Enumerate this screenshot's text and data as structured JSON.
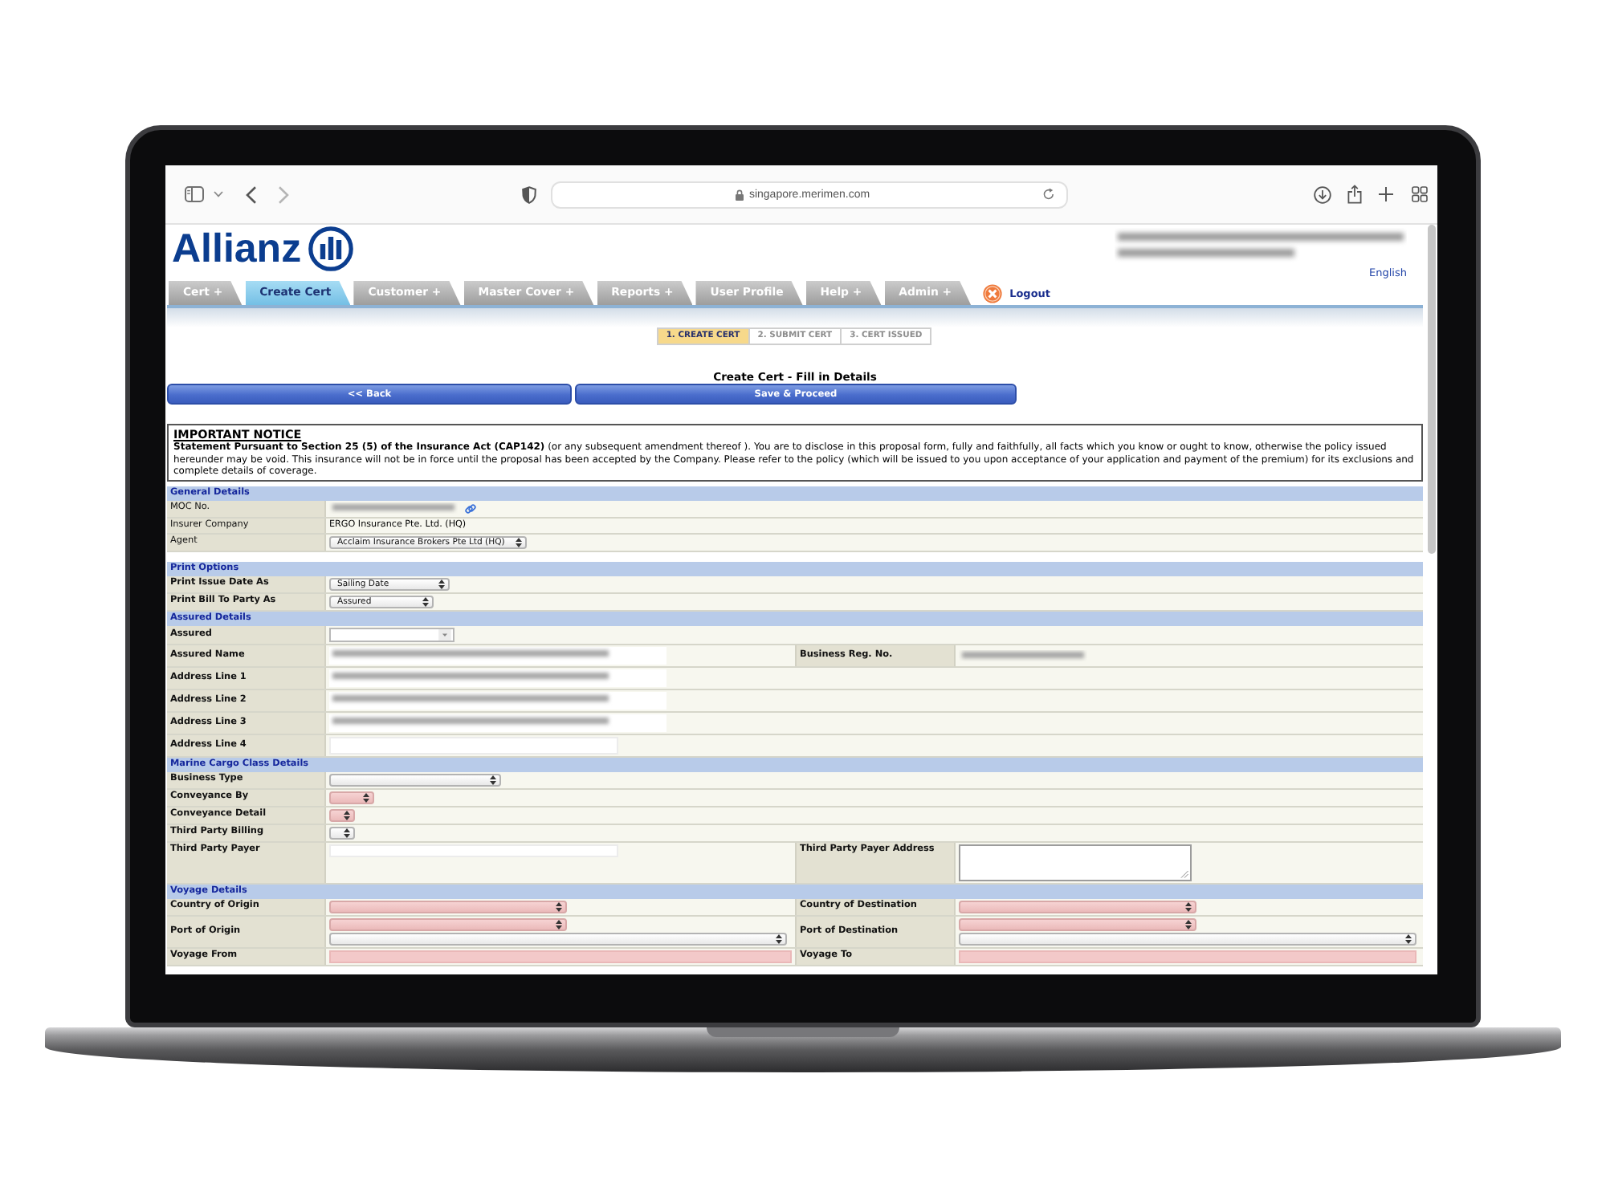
{
  "browser": {
    "url": "singapore.merimen.com"
  },
  "header": {
    "logo": "Allianz",
    "user_info_blurred": true,
    "language": "English"
  },
  "tabs": [
    {
      "label": "Cert +",
      "selected": false
    },
    {
      "label": "Create Cert",
      "selected": true
    },
    {
      "label": "Customer +",
      "selected": false
    },
    {
      "label": "Master Cover +",
      "selected": false
    },
    {
      "label": "Reports +",
      "selected": false
    },
    {
      "label": "User Profile",
      "selected": false
    },
    {
      "label": "Help +",
      "selected": false
    },
    {
      "label": "Admin +",
      "selected": false
    }
  ],
  "logout": "Logout",
  "steps": [
    {
      "label": "1. CREATE CERT",
      "selected": true
    },
    {
      "label": "2. SUBMIT CERT",
      "selected": false
    },
    {
      "label": "3. CERT ISSUED",
      "selected": false
    }
  ],
  "title": "Create Cert - Fill in Details",
  "buttons": [
    "<< Back",
    "Save & Proceed"
  ],
  "notice": {
    "heading": "IMPORTANT NOTICE",
    "text": "**Statement Pursuant to Section 25 (5) of the Insurance Act (CAP142)** (or any subsequent amendment thereof ). You are to disclose in this proposal form, fully and faithfully, all facts which you know or ought to know, otherwise the policy issued hereunder may be void. This insurance will not be in force until the proposal has been accepted by the Company. Please refer to the policy (which will be issued to you upon acceptance of your application and payment of the premium) for its exclusions and complete details of coverage."
  },
  "sections": [
    {
      "title": "General Details",
      "bold_labels": false,
      "rows": [
        {
          "label": "MOC No.",
          "fields": [
            {
              "kind": "blurred",
              "linked": true
            }
          ]
        },
        {
          "label": "Insurer Company",
          "fields": [
            {
              "kind": "text",
              "value": "ERGO Insurance Pte. Ltd. (HQ)"
            }
          ]
        },
        {
          "label": "Agent",
          "fields": [
            {
              "kind": "select",
              "value": "Acclaim Insurance Brokers Pte Ltd (HQ)",
              "required": false
            }
          ]
        }
      ]
    },
    {
      "title": "Print Options",
      "bold_labels": true,
      "rows": [
        {
          "label": "Print Issue Date As",
          "fields": [
            {
              "kind": "select",
              "value": "Sailing Date",
              "required": false
            }
          ]
        },
        {
          "label": "Print Bill To Party As",
          "fields": [
            {
              "kind": "select",
              "value": "Assured",
              "required": false
            }
          ]
        }
      ]
    },
    {
      "title": "Assured Details",
      "bold_labels": true,
      "rows": [
        {
          "label": "Assured",
          "fields": [
            {
              "kind": "combo",
              "required": false
            }
          ]
        },
        {
          "label": "Assured Name",
          "fields": [
            {
              "kind": "blurred-field"
            }
          ],
          "right": {
            "label": "Business Reg. No.",
            "fields": [
              {
                "kind": "blurred"
              }
            ]
          }
        },
        {
          "label": "Address Line 1",
          "fields": [
            {
              "kind": "blurred-field"
            }
          ]
        },
        {
          "label": "Address Line 2",
          "fields": [
            {
              "kind": "blurred-field"
            }
          ]
        },
        {
          "label": "Address Line 3",
          "fields": [
            {
              "kind": "blurred-field"
            }
          ]
        },
        {
          "label": "Address Line 4",
          "fields": [
            {
              "kind": "input",
              "required": false
            }
          ]
        }
      ]
    },
    {
      "title": "Marine Cargo Class Details",
      "bold_labels": true,
      "rows": [
        {
          "label": "Business Type",
          "fields": [
            {
              "kind": "select",
              "required": false
            }
          ]
        },
        {
          "label": "Conveyance By",
          "fields": [
            {
              "kind": "select",
              "required": true
            }
          ]
        },
        {
          "label": "Conveyance Detail",
          "fields": [
            {
              "kind": "select",
              "required": true
            }
          ]
        },
        {
          "label": "Third Party Billing",
          "fields": [
            {
              "kind": "select",
              "required": false
            }
          ]
        },
        {
          "label": "Third Party Payer",
          "fields": [
            {
              "kind": "input",
              "required": false
            }
          ],
          "right": {
            "label": "Third Party Payer Address",
            "fields": [
              {
                "kind": "textarea",
                "required": false
              }
            ]
          }
        }
      ]
    },
    {
      "title": "Voyage Details",
      "bold_labels": true,
      "rows": [
        {
          "label": "Country of Origin",
          "fields": [
            {
              "kind": "select",
              "required": true
            }
          ],
          "right": {
            "label": "Country of Destination",
            "fields": [
              {
                "kind": "select",
                "required": true
              }
            ]
          }
        },
        {
          "label": "Port of Origin",
          "fields": [
            {
              "kind": "select",
              "required": true
            },
            {
              "kind": "select",
              "required": false
            }
          ],
          "right": {
            "label": "Port of Destination",
            "fields": [
              {
                "kind": "select",
                "required": true
              },
              {
                "kind": "select",
                "required": false
              }
            ]
          }
        },
        {
          "label": "Voyage From",
          "fields": [
            {
              "kind": "input",
              "required": true
            }
          ],
          "right": {
            "label": "Voyage To",
            "fields": [
              {
                "kind": "input",
                "required": true
              }
            ]
          }
        }
      ]
    }
  ]
}
